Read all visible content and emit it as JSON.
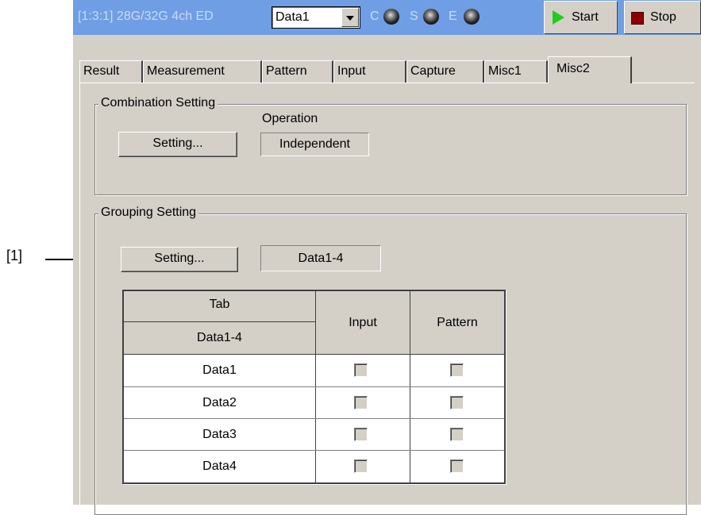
{
  "titlebar": {
    "instrument": "[1:3:1] 28G/32G 4ch ED",
    "channel_select": "Data1",
    "indicators": [
      {
        "label": "C"
      },
      {
        "label": "S"
      },
      {
        "label": "E"
      }
    ],
    "start_label": "Start",
    "stop_label": "Stop"
  },
  "tabs": [
    "Result",
    "Measurement",
    "Pattern",
    "Input",
    "Capture",
    "Misc1",
    "Misc2"
  ],
  "active_tab": "Misc2",
  "combination": {
    "title": "Combination Setting",
    "operation_label": "Operation",
    "setting_button": "Setting...",
    "operation_value": "Independent"
  },
  "grouping": {
    "title": "Grouping Setting",
    "setting_button": "Setting...",
    "group_value": "Data1-4",
    "table": {
      "tab_header": "Tab",
      "group_header": "Data1-4",
      "input_header": "Input",
      "pattern_header": "Pattern",
      "rows": [
        {
          "name": "Data1",
          "input": false,
          "pattern": false
        },
        {
          "name": "Data2",
          "input": false,
          "pattern": false
        },
        {
          "name": "Data3",
          "input": false,
          "pattern": false
        },
        {
          "name": "Data4",
          "input": false,
          "pattern": false
        }
      ]
    }
  },
  "annotation": {
    "label": "[1]"
  },
  "colors": {
    "titlebar": "#6f9ee4",
    "panel": "#d4d0c8",
    "start_icon": "#1fcc1f",
    "stop_icon": "#8b0000"
  }
}
